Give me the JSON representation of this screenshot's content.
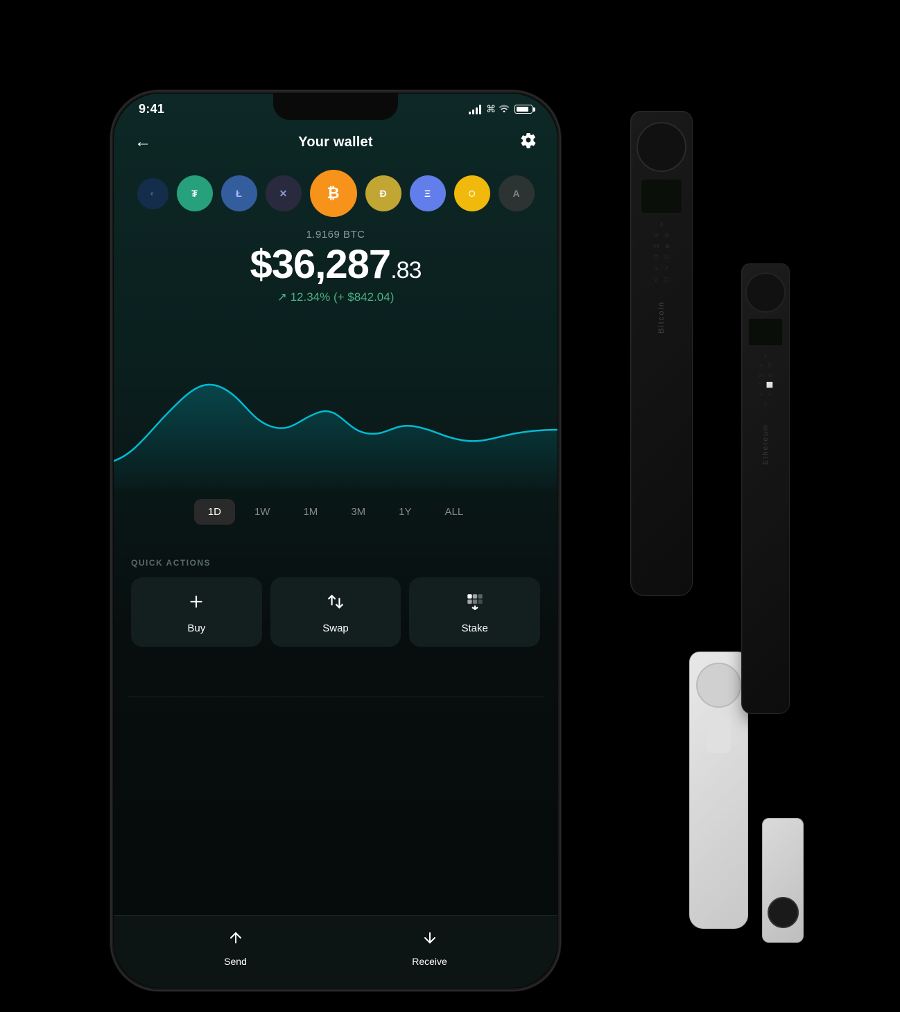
{
  "app": {
    "title": "Your wallet"
  },
  "status_bar": {
    "time": "9:41",
    "signal": "signal",
    "wifi": "wifi",
    "battery": "battery"
  },
  "header": {
    "back_label": "←",
    "title": "Your wallet",
    "settings_label": "⚙"
  },
  "coins": [
    {
      "id": "partial",
      "symbol": "",
      "color": "#2255aa"
    },
    {
      "id": "usdt",
      "symbol": "₮",
      "color": "#26a17b"
    },
    {
      "id": "ltc",
      "symbol": "Ł",
      "color": "#345d9d"
    },
    {
      "id": "xrp",
      "symbol": "✕",
      "color": "#2a2a3e"
    },
    {
      "id": "btc",
      "symbol": "₿",
      "color": "#f7931a"
    },
    {
      "id": "doge",
      "symbol": "Ð",
      "color": "#c2a633"
    },
    {
      "id": "eth",
      "symbol": "Ξ",
      "color": "#627eea"
    },
    {
      "id": "bnb",
      "symbol": "BNB",
      "color": "#f0b90b"
    },
    {
      "id": "algo",
      "symbol": "A",
      "color": "#3a3a3a"
    }
  ],
  "balance": {
    "crypto_amount": "1.9169 BTC",
    "fiat_main": "$36,287",
    "fiat_cents": ".83",
    "change_pct": "↗ 12.34% (+ $842.04)",
    "change_color": "#4caf82"
  },
  "chart": {
    "color": "#00bcd4",
    "time_range": "1D"
  },
  "time_filters": [
    {
      "label": "1D",
      "active": true
    },
    {
      "label": "1W",
      "active": false
    },
    {
      "label": "1M",
      "active": false
    },
    {
      "label": "3M",
      "active": false
    },
    {
      "label": "1Y",
      "active": false
    },
    {
      "label": "ALL",
      "active": false
    }
  ],
  "quick_actions": {
    "label": "QUICK ACTIONS",
    "buttons": [
      {
        "id": "buy",
        "icon": "+",
        "label": "Buy"
      },
      {
        "id": "swap",
        "icon": "⇄",
        "label": "Swap"
      },
      {
        "id": "stake",
        "icon": "↑↓",
        "label": "Stake"
      }
    ]
  },
  "bottom_nav": [
    {
      "id": "send",
      "icon": "↑",
      "label": "Send"
    },
    {
      "id": "receive",
      "icon": "↓",
      "label": "Receive"
    }
  ],
  "ledger_devices": {
    "tall_black": {
      "text": "Bitcoin",
      "color": "#1a1a1a"
    },
    "nano_black": {
      "text": "Ethereum",
      "color": "#1c1c1c"
    },
    "white": {
      "color": "#e0e0e0"
    }
  }
}
